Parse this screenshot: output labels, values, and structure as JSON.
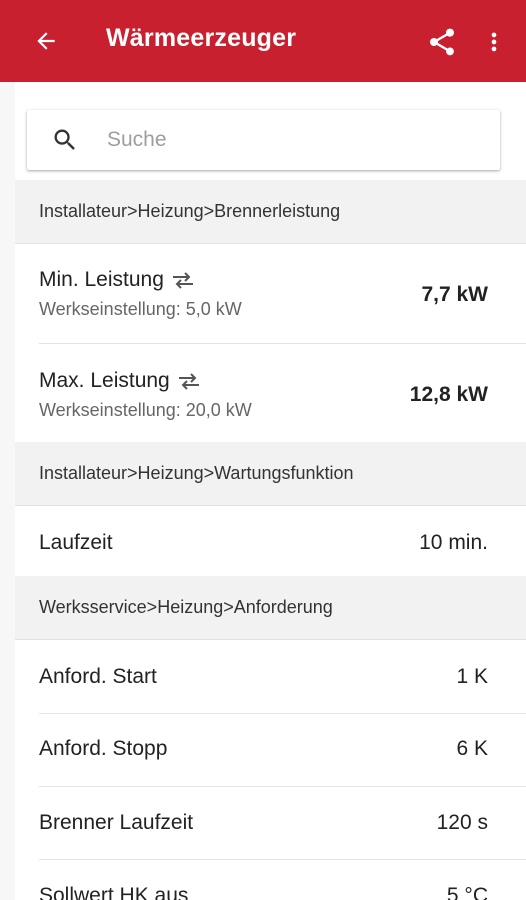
{
  "appbar": {
    "title": "Wärmeerzeuger",
    "icons": {
      "back": "arrow-back-icon",
      "share": "share-icon",
      "more": "more-vert-icon"
    },
    "color": "#c8202f"
  },
  "search": {
    "placeholder": "Suche",
    "value": ""
  },
  "sections": [
    {
      "header": "Installateur>Heizung>Brennerleistung",
      "rows": [
        {
          "label": "Min. Leistung",
          "sub": "Werkseinstellung: 5,0 kW",
          "value": "7,7 kW"
        },
        {
          "label": "Max. Leistung",
          "sub": "Werkseinstellung: 20,0 kW",
          "value": "12,8 kW"
        }
      ]
    },
    {
      "header": "Installateur>Heizung>Wartungsfunktion",
      "rows": [
        {
          "label": "Laufzeit",
          "value": "10 min."
        }
      ]
    },
    {
      "header": "Werksservice>Heizung>Anforderung",
      "rows": [
        {
          "label": "Anford. Start",
          "value": "1 K"
        },
        {
          "label": "Anford. Stopp",
          "value": "6 K"
        },
        {
          "label": "Brenner Laufzeit",
          "value": "120 s"
        },
        {
          "label": "Sollwert HK aus",
          "value": "5 °C"
        }
      ]
    }
  ]
}
